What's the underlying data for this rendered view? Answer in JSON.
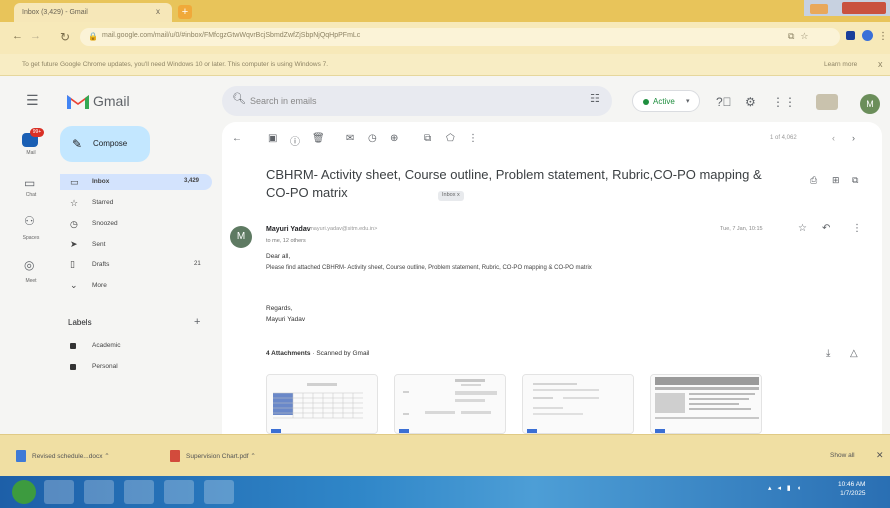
{
  "browser": {
    "tab_title": "Inbox (3,429) - Gmail",
    "new_tab": "+",
    "tab_close": "x",
    "url": "mail.google.com/mail/u/0/#inbox/FMfcgzGtwWqvrBcjSbmdZwfZjSbpNjQqHpPFmLc",
    "info_text": "To get future Google Chrome updates, you'll need Windows 10 or later. This computer is using Windows 7.",
    "info_learn": "Learn more",
    "info_close": "x"
  },
  "gmail": {
    "app_name": "Gmail",
    "search_placeholder": "Search in emails",
    "status": "Active",
    "avatar_initial": "M",
    "rail": [
      {
        "label": "Mail",
        "badge": "99+"
      },
      {
        "label": "Chat"
      },
      {
        "label": "Spaces"
      },
      {
        "label": "Meet"
      }
    ],
    "compose_label": "Compose",
    "nav": [
      {
        "label": "Inbox",
        "count": "3,429"
      },
      {
        "label": "Starred"
      },
      {
        "label": "Snoozed"
      },
      {
        "label": "Sent"
      },
      {
        "label": "Drafts",
        "count": "21"
      },
      {
        "label": "More"
      }
    ],
    "labels_heading": "Labels",
    "labels_add": "+",
    "labels": [
      "Academic",
      "Personal"
    ],
    "page_count": "1 of 4,062",
    "email": {
      "subject": "CBHRM- Activity sheet, Course outline, Problem statement, Rubric,CO-PO mapping & CO-PO matrix",
      "inbox_tag": "Inbox x",
      "sender_initial": "M",
      "sender_name": "Mayuri Yadav",
      "sender_email": "<mayuri.yadav@sitm.edu.in>",
      "to": "to me, 12 others",
      "date": "Tue, 7 Jan, 10:15",
      "greeting": "Dear all,",
      "body": "Please find attached CBHRM- Activity sheet, Course outline, Problem statement, Rubric, CO-PO mapping & CO-PO matrix",
      "regards": "Regards,",
      "signature": "Mayuri Yadav",
      "attachments_heading": "4 Attachments",
      "attachments_scan": " · Scanned by Gmail"
    }
  },
  "downloads": [
    {
      "name": "Revised schedule...docx"
    },
    {
      "name": "Supervision Chart.pdf"
    }
  ],
  "downloads_show_all": "Show all",
  "taskbar": {
    "clock_time": "10:46 AM",
    "clock_date": "1/7/2025"
  },
  "colors": {
    "chrome_tabstrip": "#e8c45a",
    "gmail_bg": "#f5f5f3",
    "compose": "#c3e7ff",
    "inbox_selected": "#d3e3fd",
    "active_green": "#1e8e3e",
    "badge_red": "#d93025"
  }
}
